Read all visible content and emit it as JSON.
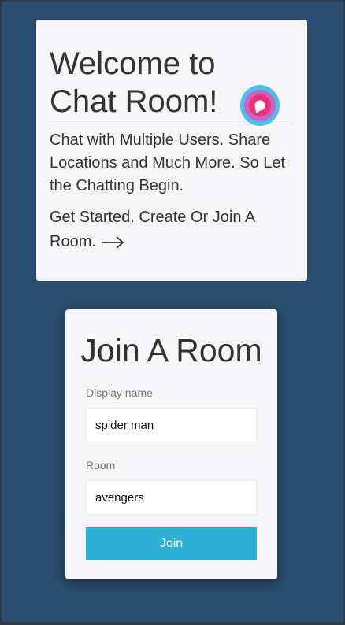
{
  "welcome": {
    "title_line1": "Welcome to",
    "title_line2": "Chat Room!",
    "description": "Chat with Multiple Users. Share Locations and Much More. So Let the Chatting Begin.",
    "get_started": "Get Started. Create Or Join A Room.",
    "icons": {
      "logo": "chat-bubble-icon",
      "arrow": "arrow-right-icon"
    },
    "colors": {
      "icon_pink": "#ec2f78",
      "icon_purple": "#c566c4",
      "icon_blue": "#4cc0ec"
    }
  },
  "join_form": {
    "title": "Join A Room",
    "display_name_label": "Display name",
    "display_name_value": "spider man",
    "room_label": "Room",
    "room_value": "avengers",
    "submit_label": "Join"
  },
  "colors": {
    "background": "#2b4d6f",
    "card": "#f6f6f8",
    "button": "#2fb0d6",
    "button_text": "#ffffff"
  }
}
